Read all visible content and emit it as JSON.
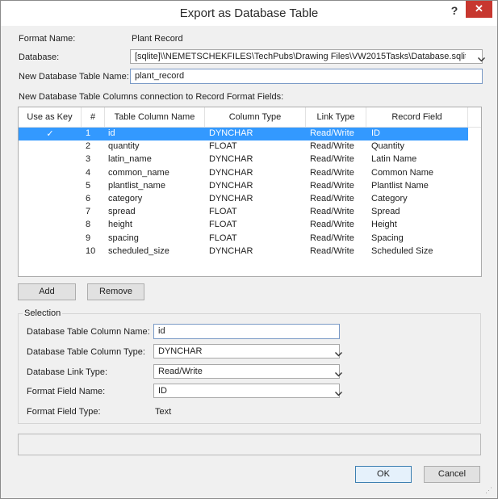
{
  "window": {
    "title": "Export as Database Table",
    "help_label": "?",
    "close_label": "✕"
  },
  "form": {
    "format_name_label": "Format Name:",
    "format_name_value": "Plant Record",
    "database_label": "Database:",
    "database_value": "[sqlite]\\\\NEMETSCHEKFILES\\TechPubs\\Drawing Files\\VW2015Tasks\\Database.sqlite",
    "table_name_label": "New Database Table Name:",
    "table_name_value": "plant_record",
    "columns_caption": "New Database Table Columns connection to Record Format Fields:"
  },
  "table": {
    "headers": [
      "Use as Key",
      "#",
      "Table Column Name",
      "Column Type",
      "Link Type",
      "Record Field"
    ],
    "selected_row": 0,
    "key_mark": "✓",
    "rows": [
      {
        "key": true,
        "num": "1",
        "name": "id",
        "type": "DYNCHAR",
        "link": "Read/Write",
        "field": "ID"
      },
      {
        "key": false,
        "num": "2",
        "name": "quantity",
        "type": "FLOAT",
        "link": "Read/Write",
        "field": "Quantity"
      },
      {
        "key": false,
        "num": "3",
        "name": "latin_name",
        "type": "DYNCHAR",
        "link": "Read/Write",
        "field": "Latin Name"
      },
      {
        "key": false,
        "num": "4",
        "name": "common_name",
        "type": "DYNCHAR",
        "link": "Read/Write",
        "field": "Common Name"
      },
      {
        "key": false,
        "num": "5",
        "name": "plantlist_name",
        "type": "DYNCHAR",
        "link": "Read/Write",
        "field": "Plantlist Name"
      },
      {
        "key": false,
        "num": "6",
        "name": "category",
        "type": "DYNCHAR",
        "link": "Read/Write",
        "field": "Category"
      },
      {
        "key": false,
        "num": "7",
        "name": "spread",
        "type": "FLOAT",
        "link": "Read/Write",
        "field": "Spread"
      },
      {
        "key": false,
        "num": "8",
        "name": "height",
        "type": "FLOAT",
        "link": "Read/Write",
        "field": "Height"
      },
      {
        "key": false,
        "num": "9",
        "name": "spacing",
        "type": "FLOAT",
        "link": "Read/Write",
        "field": "Spacing"
      },
      {
        "key": false,
        "num": "10",
        "name": "scheduled_size",
        "type": "DYNCHAR",
        "link": "Read/Write",
        "field": "Scheduled Size"
      }
    ]
  },
  "buttons": {
    "add": "Add",
    "remove": "Remove",
    "ok": "OK",
    "cancel": "Cancel"
  },
  "selection": {
    "title": "Selection",
    "col_name_label": "Database Table Column Name:",
    "col_name_value": "id",
    "col_type_label": "Database Table Column Type:",
    "col_type_value": "DYNCHAR",
    "link_type_label": "Database Link Type:",
    "link_type_value": "Read/Write",
    "field_name_label": "Format Field Name:",
    "field_name_value": "ID",
    "field_type_label": "Format Field Type:",
    "field_type_value": "Text"
  },
  "status_text": ""
}
